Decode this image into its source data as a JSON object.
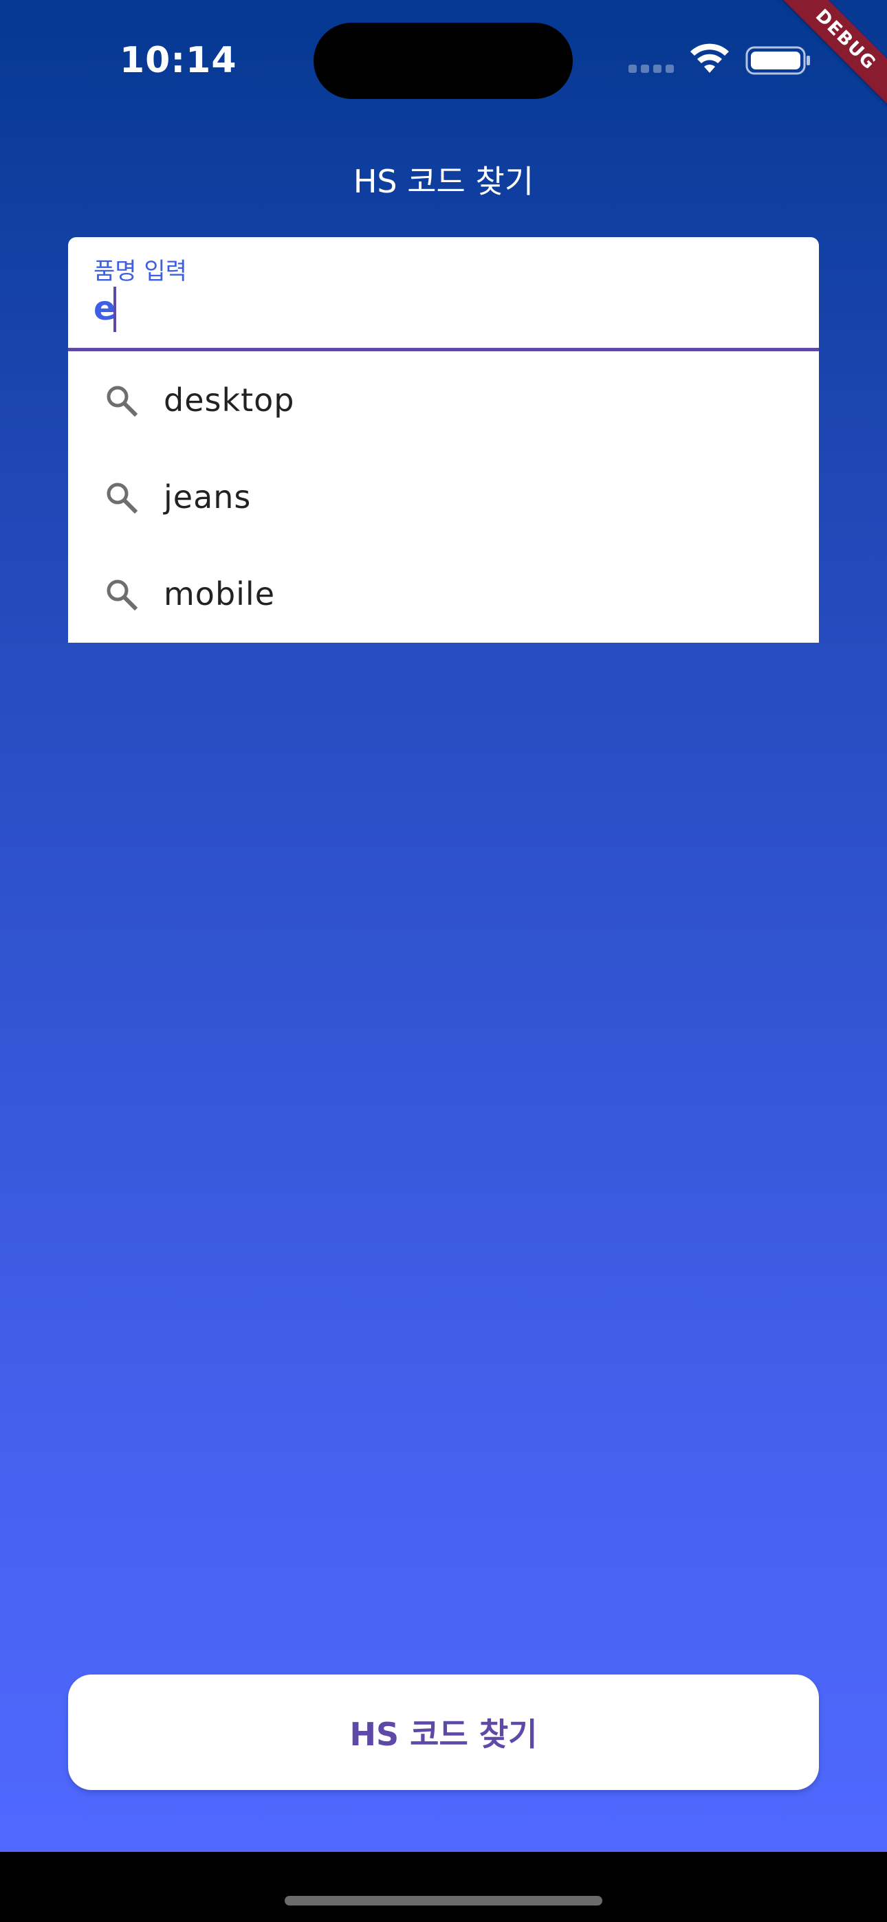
{
  "status_bar": {
    "time": "10:14"
  },
  "debug_banner": "DEBUG",
  "app_bar": {
    "title": "HS 코드 찾기"
  },
  "search_field": {
    "label": "품명 입력",
    "value": "e"
  },
  "suggestions": [
    {
      "text": "desktop",
      "icon": "search-icon"
    },
    {
      "text": "jeans",
      "icon": "search-icon"
    },
    {
      "text": "mobile",
      "icon": "search-icon"
    }
  ],
  "primary_button": {
    "label": "HS 코드 찾기"
  },
  "colors": {
    "accent": "#5e49a6",
    "label_blue": "#3f5ee6",
    "gradient_top": "#043891",
    "gradient_bottom": "#5068fe",
    "debug_red": "#8a1c30"
  }
}
